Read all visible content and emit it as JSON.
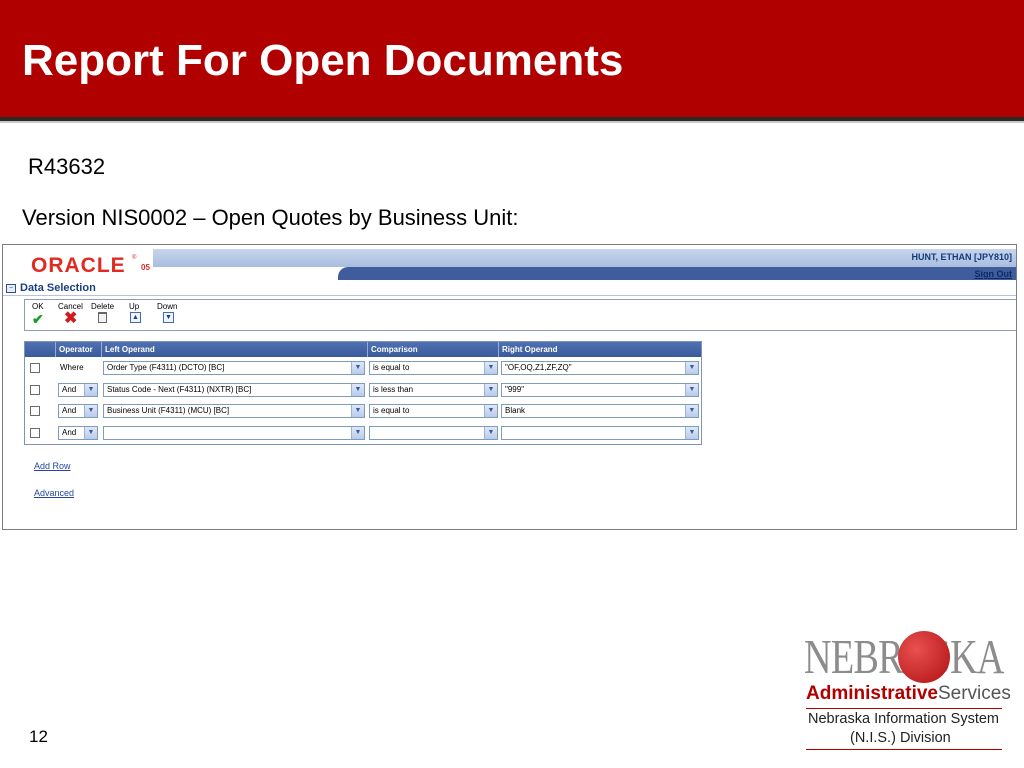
{
  "slide": {
    "title": "Report For Open Documents",
    "report_id": "R43632",
    "version_line": "Version NIS0002 – Open Quotes by Business Unit:",
    "page_number": "12"
  },
  "app": {
    "brand": "ORACLE",
    "brand_tm": "®",
    "brand_suffix": "05",
    "user": "HUNT, ETHAN [JPY810]",
    "sign_out": "Sign Out",
    "section_title": "Data Selection",
    "toolbar": {
      "ok": "OK",
      "cancel": "Cancel",
      "delete": "Delete",
      "up": "Up",
      "down": "Down"
    },
    "grid": {
      "headers": [
        "Operator",
        "Left Operand",
        "Comparison",
        "Right Operand"
      ],
      "rows": [
        {
          "operator": "Where",
          "left": "Order Type (F4311) (DCTO) [BC]",
          "comparison": "is equal to",
          "right": "\"OF,OQ,Z1,ZF,ZQ\""
        },
        {
          "operator": "And",
          "left": "Status Code - Next (F4311) (NXTR) [BC]",
          "comparison": "is less than",
          "right": "\"999\""
        },
        {
          "operator": "And",
          "left": "Business Unit (F4311) (MCU) [BC]",
          "comparison": "is equal to",
          "right": "Blank"
        },
        {
          "operator": "And",
          "left": "",
          "comparison": "",
          "right": ""
        }
      ]
    },
    "links": {
      "add_row": "Add Row",
      "advanced": "Advanced"
    }
  },
  "logo": {
    "wordmark": "NEBRASKA",
    "admin_bold": "Administrative",
    "admin_rest": "Services",
    "nis_line1": "Nebraska Information System",
    "nis_line2": "(N.I.S.) Division"
  },
  "colors": {
    "header_red": "#b00000",
    "oracle_red": "#e02a22",
    "grid_header_blue": "#3a5a9a"
  }
}
